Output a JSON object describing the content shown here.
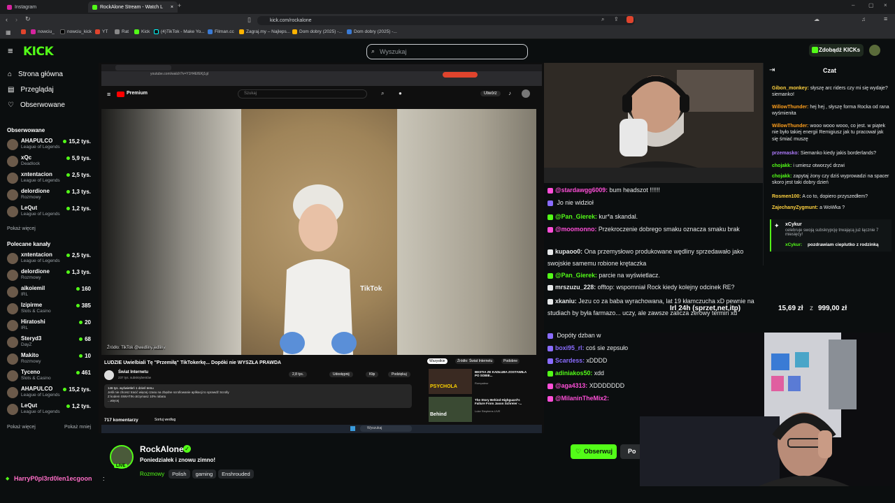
{
  "browser": {
    "tabs": [
      {
        "label": "Instagram",
        "active": false
      },
      {
        "label": "RockAlone Stream - Watch L",
        "active": true
      }
    ],
    "url": "kick.com/rockalone",
    "bookmarks": [
      "nowciu_",
      "nowciu_kick",
      "YT",
      "Rat",
      "Kick",
      "(4)TikTok - Make Yo...",
      "Filman.cc",
      "Zagraj.my – Najleps...",
      "Dom dobry (2025) -...",
      "Dom dobry (2025) -..."
    ]
  },
  "header": {
    "logo": "KICK",
    "search_placeholder": "Wyszukaj",
    "kicks_button": "Zdobądź KICKs"
  },
  "sidebar": {
    "nav": [
      {
        "label": "Strona główna",
        "icon": "home-icon"
      },
      {
        "label": "Przeglądaj",
        "icon": "browse-icon"
      },
      {
        "label": "Obserwowane",
        "icon": "heart-icon"
      }
    ],
    "followed_title": "Obserwowane",
    "followed": [
      {
        "name": "AHAPULCO",
        "game": "League of Legends",
        "viewers": "15,2 tys."
      },
      {
        "name": "xQc",
        "game": "Deadlock",
        "viewers": "5,9 tys."
      },
      {
        "name": "xntentacion",
        "game": "League of Legends",
        "viewers": "2,5 tys."
      },
      {
        "name": "delordione",
        "game": "Rozmowy",
        "viewers": "1,3 tys."
      },
      {
        "name": "LeQut",
        "game": "League of Legends",
        "viewers": "1,2 tys."
      }
    ],
    "show_more": "Pokaż więcej",
    "recommended_title": "Polecane kanały",
    "recommended": [
      {
        "name": "xntentacion",
        "game": "League of Legends",
        "viewers": "2,5 tys."
      },
      {
        "name": "delordione",
        "game": "Rozmowy",
        "viewers": "1,3 tys."
      },
      {
        "name": "aikoiemil",
        "game": "IRL",
        "viewers": "160"
      },
      {
        "name": "Izipirme",
        "game": "Slots & Casino",
        "viewers": "385"
      },
      {
        "name": "Hiratoshi",
        "game": "IRL",
        "viewers": "20"
      },
      {
        "name": "Steryd3",
        "game": "DayZ",
        "viewers": "68"
      },
      {
        "name": "Makito",
        "game": "Rozmowy",
        "viewers": "10"
      },
      {
        "name": "Tyceno",
        "game": "Slots & Casino",
        "viewers": "461"
      },
      {
        "name": "AHAPULCO",
        "game": "League of Legends",
        "viewers": "15,2 tys."
      },
      {
        "name": "LeQut",
        "game": "League of Legends",
        "viewers": "1,2 tys."
      }
    ],
    "show_more_2": "Pokaż więcej",
    "show_less": "Pokaż mniej"
  },
  "video": {
    "inner_url": "youtube.com/watch?v=Y1H4EfEKj1gI",
    "yt_logo": "Premium",
    "yt_search": "Szukaj",
    "yt_create": "Utwórz",
    "tiktok_watermark": "TikTok",
    "source_label": "Źródło: TikTok @wedliny.jedliny",
    "title": "LUDZIE Uwielbiali Tę \"Przemiłą\" TikTokerkę... Dopóki nie WYSZŁA PRAWDA",
    "channel": "Świat Internetu",
    "subs": "237 tys. subskrybentów",
    "likes": "2,8 tys.",
    "share": "Udostępnij",
    "clip": "Klip",
    "thank": "Podziękuj",
    "desc_1": "146 tys. wyświetleń 1 dzień temu",
    "desc_2": "Jeśli nie chcesz tracić więcej czasu na zbędne scrollowanie aplikacji to sprawdź Scrolly",
    "desc_3": "Z kodem SWIATIN otrzymasz 10% rabatu",
    "desc_more": "...więcej",
    "comments": "717 komentarzy",
    "sort": "Sortuj według",
    "side_chips": [
      "Wszystkie",
      "Źródło: Świat Internetu",
      "Podobne"
    ],
    "side_videos": [
      {
        "title": "BESTIA ZE KADŁUBA ZOSTAWIŁA PO SOBIE...",
        "channel": "Rompaleur"
      },
      {
        "title": "The Story Behind Highguard's Failure From Jason Schreier -...",
        "channel": "Luke Stephens LIVE"
      }
    ],
    "thumb_text": "PSYCHOLA",
    "thumb_text_2": "Behind",
    "taskbar_search": "Wyszukaj"
  },
  "overlay_chat": [
    {
      "user": "@stardawgg6009:",
      "msg": "bum headszot !!!!!!",
      "color": "#ff4fd8"
    },
    {
      "user": "",
      "msg": "Jo nie widzioł",
      "color": "#8a6cff"
    },
    {
      "user": "@Pan_Gierek:",
      "msg": "kur*a skandal.",
      "color": "#53fc18"
    },
    {
      "user": "@moomonno:",
      "msg": "Przekroczenie dobrego smaku oznacza smaku brak",
      "color": "#ff4fd8"
    },
    {
      "user": "kupaoo0:",
      "msg": "Ona przemysłowo produkowane wędliny sprzedawało jako swojskie samemu robione krętaczka",
      "color": "#e7e9ea"
    },
    {
      "user": "@Pan_Gierek:",
      "msg": "parcie na wyświetlacz.",
      "color": "#53fc18"
    },
    {
      "user": "mrszuzu_228:",
      "msg": "offtop: wspomniał Rock kiedy kolejny odcinek RE?",
      "color": "#e7e9ea"
    },
    {
      "user": "xkaniu:",
      "msg": "Jezu co za baba wyrachowana, lat 19 kłamczucha xD pewnie na studiach by była farmazo... uczy, ale zawsze zalicza zerowy termin xd",
      "color": "#e7e9ea"
    },
    {
      "user": "",
      "msg": "Dopóty dzban w",
      "color": "#8a6cff"
    },
    {
      "user": "boxi95_rl:",
      "msg": "coś sie zepsuło",
      "color": "#8a6cff"
    },
    {
      "user": "Scardess:",
      "msg": "xDDDD",
      "color": "#8a6cff"
    },
    {
      "user": "adiniakos50:",
      "msg": "xdd",
      "color": "#53fc18"
    },
    {
      "user": "@aga4313:",
      "msg": "XDDDDDDD",
      "color": "#ff4fd8"
    },
    {
      "user": "@MilaninTheMix2:",
      "msg": "",
      "color": "#ff4fd8"
    }
  ],
  "chat": {
    "title": "Czat",
    "messages": [
      {
        "user": "Gibon_monkey:",
        "msg": "słyszę arc riders czy mi się wydaje? siemanko!",
        "color": "#ffd23f"
      },
      {
        "user": "WillowThunder:",
        "msg": "hej hej , słyszę forma Rocka od rana wyśmienita",
        "color": "#ff9f1c"
      },
      {
        "user": "WillowThunder:",
        "msg": "wooo wooo wooo, co jest. w piątek nie było takiej energii Remigiusz jak tu pracował jak się śmiać muszę",
        "color": "#ff9f1c"
      },
      {
        "user": "przemasko:",
        "msg": "Siemanko kiedy jakis borderlands?",
        "color": "#b07cff"
      },
      {
        "user": "chojakk:",
        "msg": "i umiesz otworzyć drzwi",
        "color": "#53fc18"
      },
      {
        "user": "chojakk:",
        "msg": "zapytaj żony czy dziś wyprowadzi na spacer skoro jest taki dobry dzień",
        "color": "#53fc18"
      },
      {
        "user": "Rosmen100:",
        "msg": "A co to, dopiero przyszedłem?",
        "color": "#ffd23f"
      },
      {
        "user": "ZajechanyZygmunt:",
        "msg": "a WoWka ?",
        "color": "#ffd23f"
      }
    ],
    "sub_user": "xCykur",
    "sub_text": "celebruje swoją subskrypcję trwającą już łącznie 7 miesięcy!",
    "sub_msg_user": "xCykur:",
    "sub_msg": "pozdrawiam cieplutko z rodzinką"
  },
  "overlay_donation": {
    "label": "Irl 24h (sprzet,net,itp)",
    "amount": "15,69 zł",
    "sep": "z",
    "goal": "999,00 zł"
  },
  "stream": {
    "name": "RockAlone",
    "title": "Poniedziałek i znowu zimno!",
    "live_badge": "LIVE",
    "tags": [
      "Rozmowy",
      "Polish",
      "gaming",
      "Enshrouded"
    ],
    "follow": "Obserwuj",
    "p_btn": "Po"
  },
  "bottom_chat": {
    "user": "HarryP0pl3rd0len1ecgoon",
    "sep": ":"
  },
  "colors": {
    "accent": "#53fc18",
    "background": "#0b0e0f"
  }
}
